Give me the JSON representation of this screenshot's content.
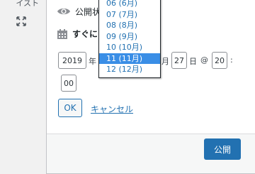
{
  "left_panel": {
    "cut_text": "イスト",
    "expand_icon": "expand-icon"
  },
  "publish_box": {
    "visibility": {
      "icon": "eye-icon",
      "label": "公開状"
    },
    "schedule": {
      "icon": "calendar-icon",
      "label": "すぐに"
    },
    "date_fields": {
      "year": "2019",
      "year_suffix": "年",
      "month_suffix": "月",
      "day": "27",
      "day_suffix": "日",
      "at_symbol": "@",
      "hour": "20",
      "time_colon": ":",
      "minute": "00"
    },
    "ok_button": "OK",
    "cancel_link": "キャンセル",
    "publish_button": "公開"
  },
  "month_dropdown": {
    "options": [
      {
        "label": "06 (6月)",
        "selected": false
      },
      {
        "label": "07 (7月)",
        "selected": false
      },
      {
        "label": "08 (8月)",
        "selected": false
      },
      {
        "label": "09 (9月)",
        "selected": false
      },
      {
        "label": "10 (10月)",
        "selected": false
      },
      {
        "label": "11 (11月)",
        "selected": true
      },
      {
        "label": "12 (12月)",
        "selected": false
      }
    ]
  },
  "colors": {
    "accent": "#2271b1",
    "selected_option": "#3a8ee6",
    "border": "#8c8f94"
  }
}
